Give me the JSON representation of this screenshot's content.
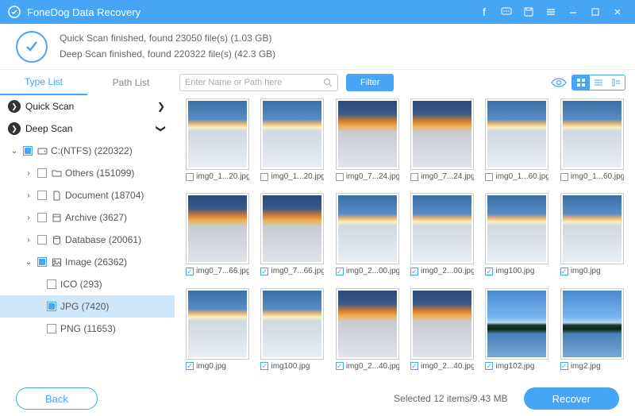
{
  "titlebar": {
    "title": "FoneDog Data Recovery"
  },
  "status": {
    "line1": "Quick Scan finished, found 23050 file(s) (1.03 GB)",
    "line2": "Deep Scan finished, found 220322 file(s) (42.3 GB)"
  },
  "sidebar": {
    "tab1": "Type List",
    "tab2": "Path List",
    "quick_scan": "Quick Scan",
    "deep_scan": "Deep Scan",
    "drive": "C:(NTFS) (220322)",
    "others": "Others (151099)",
    "document": "Document (18704)",
    "archive": "Archive (3627)",
    "database": "Database (20061)",
    "image": "Image (26362)",
    "ico": "ICO (293)",
    "jpg": "JPG (7420)",
    "png": "PNG (11653)"
  },
  "toolbar": {
    "search_placeholder": "Enter Name or Path here",
    "filter": "Filter"
  },
  "grid": [
    {
      "name": "img0_1...20.jpg",
      "checked": false,
      "style": "day"
    },
    {
      "name": "img0_1...20.jpg",
      "checked": false,
      "style": "day"
    },
    {
      "name": "img0_7...24.jpg",
      "checked": false,
      "style": "sunset"
    },
    {
      "name": "img0_7...24.jpg",
      "checked": false,
      "style": "sunset"
    },
    {
      "name": "img0_1...60.jpg",
      "checked": false,
      "style": "day"
    },
    {
      "name": "img0_1...60.jpg",
      "checked": false,
      "style": "day"
    },
    {
      "name": "img0_7...66.jpg",
      "checked": true,
      "style": "sunset"
    },
    {
      "name": "img0_7...66.jpg",
      "checked": true,
      "style": "sunset"
    },
    {
      "name": "img0_2...00.jpg",
      "checked": true,
      "style": "day"
    },
    {
      "name": "img0_2...00.jpg",
      "checked": true,
      "style": "day"
    },
    {
      "name": "img100.jpg",
      "checked": true,
      "style": "day"
    },
    {
      "name": "img0.jpg",
      "checked": true,
      "style": "day"
    },
    {
      "name": "img0.jpg",
      "checked": true,
      "style": "day"
    },
    {
      "name": "img100.jpg",
      "checked": true,
      "style": "day"
    },
    {
      "name": "img0_2...40.jpg",
      "checked": true,
      "style": "sunset"
    },
    {
      "name": "img0_2...40.jpg",
      "checked": true,
      "style": "sunset"
    },
    {
      "name": "img102.jpg",
      "checked": true,
      "style": "island"
    },
    {
      "name": "img2.jpg",
      "checked": true,
      "style": "island"
    }
  ],
  "footer": {
    "back": "Back",
    "selection": "Selected 12 items/9.43 MB",
    "recover": "Recover"
  }
}
